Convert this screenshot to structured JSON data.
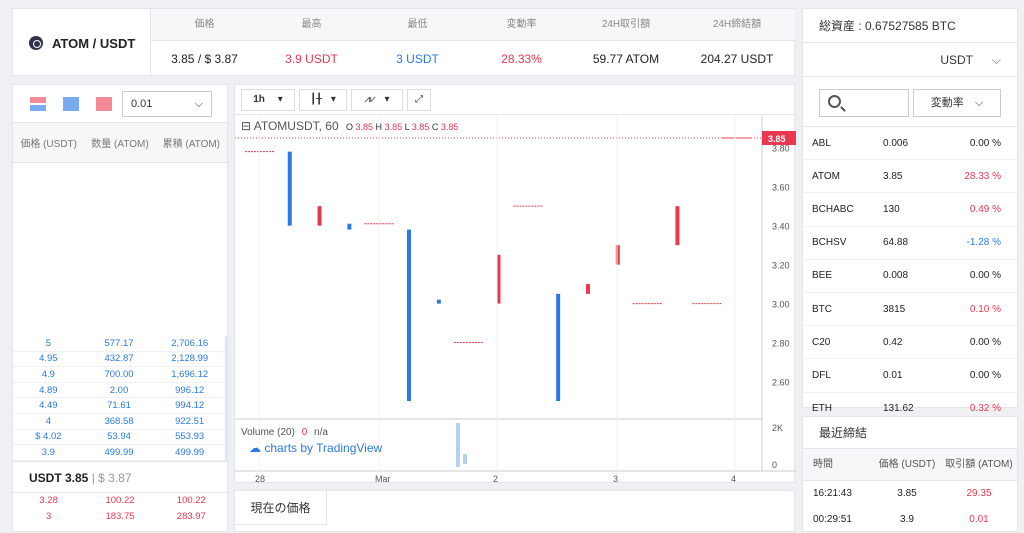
{
  "pair": "ATOM / USDT",
  "stats": [
    {
      "label": "価格",
      "value": "3.85 / $ 3.87",
      "color": "#222222"
    },
    {
      "label": "最高",
      "value": "3.9 USDT",
      "color": "#e8384f"
    },
    {
      "label": "最低",
      "value": "3 USDT",
      "color": "#2b7ae4"
    },
    {
      "label": "変動率",
      "value": "28.33%",
      "color": "#e8384f"
    },
    {
      "label": "24H取引額",
      "value": "59.77 ATOM",
      "color": "#222222"
    },
    {
      "label": "24H締結額",
      "value": "204.27 USDT",
      "color": "#222222"
    }
  ],
  "assets": {
    "total": "総資産 : 0.67527585 BTC",
    "currency": "USDT",
    "sort_label": "変動率",
    "rows": [
      {
        "sym": "ABL",
        "price": "0.006",
        "chg": "0.00 %",
        "cls": ""
      },
      {
        "sym": "ATOM",
        "price": "3.85",
        "chg": "28.33 %",
        "cls": "red"
      },
      {
        "sym": "BCHABC",
        "price": "130",
        "chg": "0.49 %",
        "cls": "red"
      },
      {
        "sym": "BCHSV",
        "price": "64.88",
        "chg": "-1.28 %",
        "cls": "blue"
      },
      {
        "sym": "BEE",
        "price": "0.008",
        "chg": "0.00 %",
        "cls": ""
      },
      {
        "sym": "BTC",
        "price": "3815",
        "chg": "0.10 %",
        "cls": "red"
      },
      {
        "sym": "C20",
        "price": "0.42",
        "chg": "0.00 %",
        "cls": ""
      },
      {
        "sym": "DFL",
        "price": "0.01",
        "chg": "0.00 %",
        "cls": ""
      },
      {
        "sym": "ETH",
        "price": "131.62",
        "chg": "0.32 %",
        "cls": "red"
      }
    ]
  },
  "recent": {
    "title": "最近締結",
    "headers": [
      "時間",
      "価格 (USDT)",
      "取引額 (ATOM)"
    ],
    "rows": [
      {
        "time": "16:21:43",
        "price": "3.85",
        "amount": "29.35"
      },
      {
        "time": "00:29:51",
        "price": "3.9",
        "amount": "0.01"
      }
    ]
  },
  "book": {
    "precision": "0.01",
    "headers": [
      "価格 (USDT)",
      "数量 (ATOM)",
      "累積 (ATOM)"
    ],
    "buys": [
      [
        "5",
        "577.17",
        "2,706.16"
      ],
      [
        "4.95",
        "432.87",
        "2,128.99"
      ],
      [
        "4.9",
        "700.00",
        "1,696.12"
      ],
      [
        "4.89",
        "2.00",
        "996.12"
      ],
      [
        "4.49",
        "71.61",
        "994.12"
      ],
      [
        "4",
        "368.58",
        "922.51"
      ],
      [
        "$ 4.02",
        "53.94",
        "553.93"
      ],
      [
        "3.9",
        "499.99",
        "499.99"
      ]
    ],
    "mid": "USDT 3.85",
    "mid_sub": "| $ 3.87",
    "sells": [
      [
        "3.28",
        "100.22",
        "100.22"
      ],
      [
        "3",
        "183.75",
        "283.97"
      ]
    ]
  },
  "chart": {
    "interval": "1h",
    "symbol": "ATOMUSDT, 60",
    "ohlc": {
      "o": "3.85",
      "h": "3.85",
      "l": "3.85",
      "c": "3.85"
    },
    "last_price": "3.85",
    "volume_label": "Volume (20)",
    "volume_val": "0",
    "volume_na": "n/a",
    "tv_label": "charts by TradingView",
    "y_ticks": [
      "3.80",
      "3.60",
      "3.40",
      "3.20",
      "3.00",
      "2.80",
      "2.60"
    ],
    "vol_ticks": [
      "2K",
      "0"
    ],
    "x_ticks": [
      "28",
      "Mar",
      "2",
      "3",
      "4"
    ]
  },
  "chart_data": {
    "type": "candlestick",
    "ylim": [
      2.5,
      3.85
    ],
    "candles": [
      {
        "o": 3.78,
        "c": 3.78,
        "h": 3.78,
        "l": 3.78,
        "dir": "flat"
      },
      {
        "o": 3.78,
        "c": 3.4,
        "h": 3.78,
        "l": 3.4,
        "dir": "down"
      },
      {
        "o": 3.4,
        "c": 3.5,
        "h": 3.5,
        "l": 3.4,
        "dir": "up"
      },
      {
        "o": 3.41,
        "c": 3.38,
        "h": 3.41,
        "l": 3.38,
        "dir": "down"
      },
      {
        "o": 3.41,
        "c": 3.41,
        "h": 3.41,
        "l": 3.41,
        "dir": "flat"
      },
      {
        "o": 3.38,
        "c": 2.5,
        "h": 3.38,
        "l": 2.5,
        "dir": "down"
      },
      {
        "o": 3.0,
        "c": 3.02,
        "h": 3.02,
        "l": 3.0,
        "dir": "down"
      },
      {
        "o": 2.8,
        "c": 2.8,
        "h": 2.8,
        "l": 2.8,
        "dir": "flat"
      },
      {
        "o": 3.0,
        "c": 3.25,
        "h": 3.5,
        "l": 3.0,
        "dir": "up"
      },
      {
        "o": 3.5,
        "c": 3.5,
        "h": 3.5,
        "l": 3.5,
        "dir": "flat"
      },
      {
        "o": 3.05,
        "c": 2.5,
        "h": 3.05,
        "l": 2.5,
        "dir": "down"
      },
      {
        "o": 3.05,
        "c": 3.1,
        "h": 3.1,
        "l": 3.05,
        "dir": "up"
      },
      {
        "o": 3.2,
        "c": 3.3,
        "h": 3.3,
        "l": 3.2,
        "dir": "up"
      },
      {
        "o": 3.0,
        "c": 3.0,
        "h": 3.0,
        "l": 3.0,
        "dir": "flat"
      },
      {
        "o": 3.3,
        "c": 3.5,
        "h": 3.5,
        "l": 3.3,
        "dir": "up"
      },
      {
        "o": 3.0,
        "c": 3.0,
        "h": 3.0,
        "l": 3.0,
        "dir": "flat"
      },
      {
        "o": 3.85,
        "c": 3.85,
        "h": 3.85,
        "l": 3.85,
        "dir": "flat"
      }
    ]
  },
  "current_price_tab": "現在の価格"
}
